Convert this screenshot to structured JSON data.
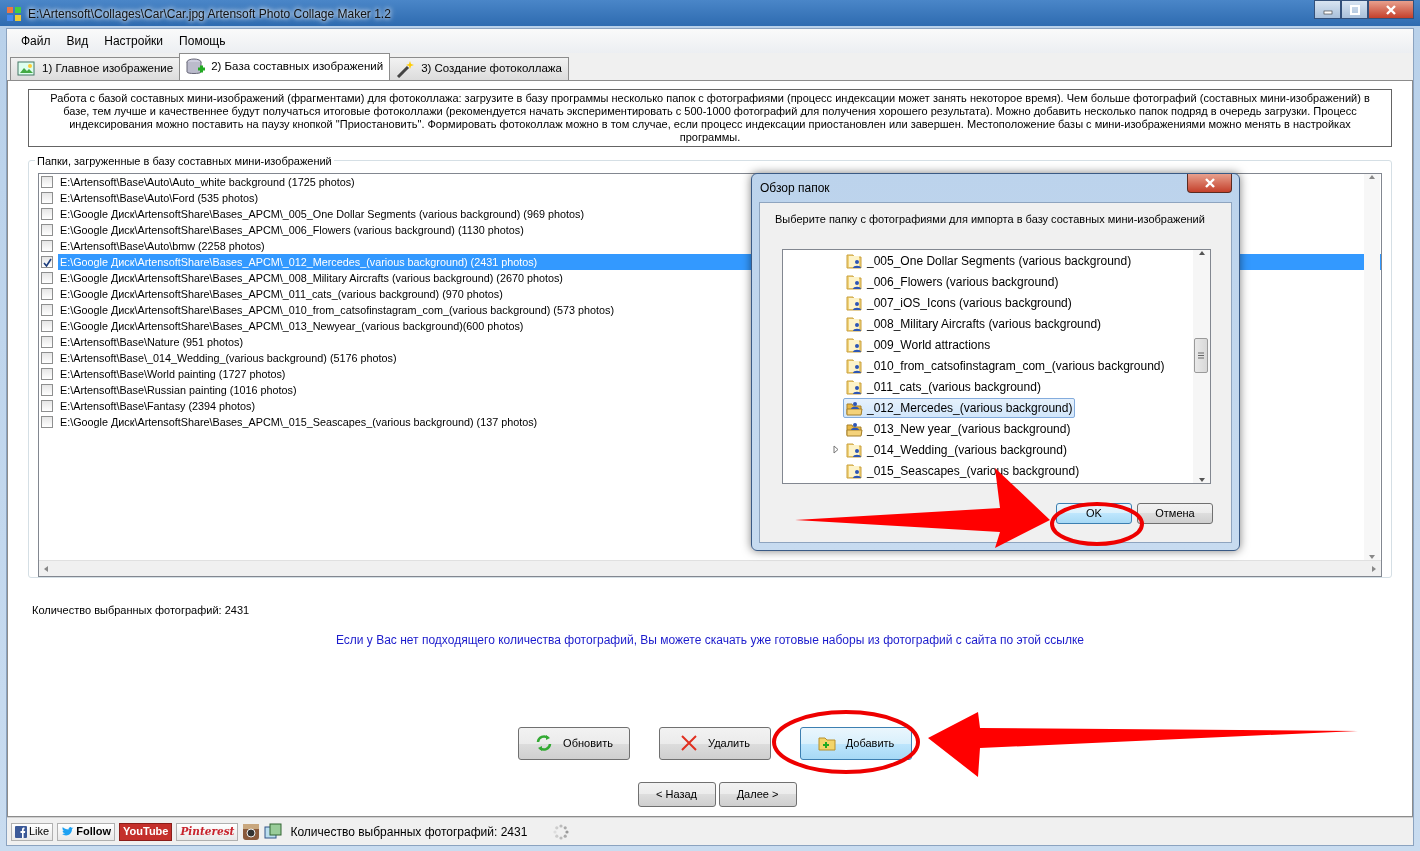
{
  "window": {
    "title": "E:\\Artensoft\\Collages\\Car\\Car.jpg Artensoft Photo Collage Maker 1.2"
  },
  "menu": [
    "Файл",
    "Вид",
    "Настройки",
    "Помощь"
  ],
  "tabs": [
    {
      "label": "1) Главное изображение",
      "selected": false,
      "kind": "image"
    },
    {
      "label": "2) База составных изображений",
      "selected": true,
      "kind": "database"
    },
    {
      "label": "3) Создание фотоколлажа",
      "selected": false,
      "kind": "wand"
    }
  ],
  "info_text": "Работа с базой составных мини-изображений (фрагментами) для фотоколлажа: загрузите в базу программы несколько папок с фотографиями (процесс индексации может занять некоторое время). Чем больше фотографий (составных мини-изображений) в базе, тем лучше и качественнее будут получаться итоговые фотоколлажи (рекомендуется начать экспериментировать с 500-1000 фотографий для получения хорошего результата). Можно добавить несколько папок подряд в очередь загрузки. Процесс индексирования можно поставить на паузу кнопкой \"Приостановить\". Формировать фотоколлаж можно в том случае, если процесс индексации приостановлен или завершен. Местоположение базы с мини-изображениями можно менять в настройках программы.",
  "folders_group": {
    "title": "Папки, загруженные в базу составных мини-изображений",
    "items": [
      {
        "text": "E:\\Artensoft\\Base\\Auto\\Auto_white background (1725 photos)",
        "checked": false,
        "selected": false
      },
      {
        "text": "E:\\Artensoft\\Base\\Auto\\Ford (535 photos)",
        "checked": false,
        "selected": false
      },
      {
        "text": "E:\\Google Диск\\ArtensoftShare\\Bases_APCM\\_005_One Dollar Segments (various background) (969 photos)",
        "checked": false,
        "selected": false
      },
      {
        "text": "E:\\Google Диск\\ArtensoftShare\\Bases_APCM\\_006_Flowers (various background) (1130 photos)",
        "checked": false,
        "selected": false
      },
      {
        "text": "E:\\Artensoft\\Base\\Auto\\bmw (2258 photos)",
        "checked": false,
        "selected": false
      },
      {
        "text": "E:\\Google Диск\\ArtensoftShare\\Bases_APCM\\_012_Mercedes_(various background) (2431 photos)",
        "checked": true,
        "selected": true
      },
      {
        "text": "E:\\Google Диск\\ArtensoftShare\\Bases_APCM\\_008_Military Aircrafts (various background) (2670 photos)",
        "checked": false,
        "selected": false
      },
      {
        "text": "E:\\Google Диск\\ArtensoftShare\\Bases_APCM\\_011_cats_(various background) (970 photos)",
        "checked": false,
        "selected": false
      },
      {
        "text": "E:\\Google Диск\\ArtensoftShare\\Bases_APCM\\_010_from_catsofinstagram_com_(various background) (573 photos)",
        "checked": false,
        "selected": false
      },
      {
        "text": "E:\\Google Диск\\ArtensoftShare\\Bases_APCM\\_013_Newyear_(various background)(600 photos)",
        "checked": false,
        "selected": false
      },
      {
        "text": "E:\\Artensoft\\Base\\Nature (951 photos)",
        "checked": false,
        "selected": false
      },
      {
        "text": "E:\\Artensoft\\Base\\_014_Wedding_(various background) (5176 photos)",
        "checked": false,
        "selected": false
      },
      {
        "text": "E:\\Artensoft\\Base\\World painting (1727 photos)",
        "checked": false,
        "selected": false
      },
      {
        "text": "E:\\Artensoft\\Base\\Russian painting (1016 photos)",
        "checked": false,
        "selected": false
      },
      {
        "text": "E:\\Artensoft\\Base\\Fantasy (2394 photos)",
        "checked": false,
        "selected": false
      },
      {
        "text": "E:\\Google Диск\\ArtensoftShare\\Bases_APCM\\_015_Seascapes_(various background) (137 photos)",
        "checked": false,
        "selected": false
      }
    ]
  },
  "selected_count": "Количество выбранных фотографий: 2431",
  "download_link": "Если у Вас нет подходящего количества фотографий, Вы можете скачать уже готовые наборы из фотографий с сайта по этой ссылке",
  "action_buttons": [
    {
      "label": "Обновить",
      "kind": "refresh"
    },
    {
      "label": "Удалить",
      "kind": "delete"
    },
    {
      "label": "Добавить",
      "kind": "add"
    }
  ],
  "nav_buttons": [
    "< Назад",
    "Далее >"
  ],
  "status_bar": {
    "social": [
      {
        "label": "Like",
        "kind": "facebook"
      },
      {
        "label": "Follow",
        "kind": "twitter"
      },
      {
        "label": "YouTube",
        "kind": "youtube"
      },
      {
        "label": "Pinterest",
        "kind": "pinterest"
      },
      {
        "kind": "instagram"
      }
    ],
    "text": "Количество выбранных фотографий: 2431"
  },
  "dialog": {
    "title": "Обзор папок",
    "prompt": "Выберите папку с фотографиями для импорта в базу составных мини-изображений",
    "tree": [
      {
        "text": "_005_One Dollar Segments (various background)",
        "selected": false,
        "expandable": false,
        "kind": "shared"
      },
      {
        "text": "_006_Flowers (various background)",
        "selected": false,
        "expandable": false,
        "kind": "shared"
      },
      {
        "text": "_007_iOS_Icons (various background)",
        "selected": false,
        "expandable": false,
        "kind": "shared"
      },
      {
        "text": "_008_Military Aircrafts (various background)",
        "selected": false,
        "expandable": false,
        "kind": "shared"
      },
      {
        "text": "_009_World attractions",
        "selected": false,
        "expandable": false,
        "kind": "shared"
      },
      {
        "text": "_010_from_catsofinstagram_com_(various background)",
        "selected": false,
        "expandable": false,
        "kind": "shared"
      },
      {
        "text": "_011_cats_(various background)",
        "selected": false,
        "expandable": false,
        "kind": "shared"
      },
      {
        "text": "_012_Mercedes_(various background)",
        "selected": true,
        "expandable": false,
        "kind": "open"
      },
      {
        "text": "_013_New year_(various background)",
        "selected": false,
        "expandable": false,
        "kind": "open"
      },
      {
        "text": "_014_Wedding_(various background)",
        "selected": false,
        "expandable": true,
        "kind": "shared"
      },
      {
        "text": "_015_Seascapes_(various background)",
        "selected": false,
        "expandable": false,
        "kind": "shared"
      }
    ],
    "buttons": [
      {
        "label": "OK",
        "default": true
      },
      {
        "label": "Отмена",
        "default": false
      }
    ]
  }
}
